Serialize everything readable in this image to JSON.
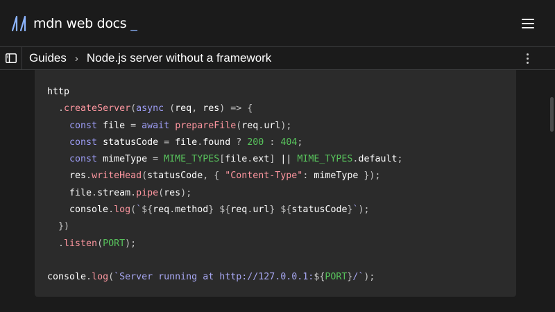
{
  "header": {
    "logo_text": "mdn web docs",
    "logo_cursor": "_",
    "logo_icon": "mdn-m-icon",
    "menu_icon": "hamburger-menu-icon"
  },
  "breadcrumb": {
    "sidebar_icon": "sidebar-toggle-icon",
    "items": [
      "Guides",
      "Node.js server without a framework"
    ],
    "separator": "›",
    "more_icon": "more-vertical-icon"
  },
  "code": {
    "lines": [
      [
        {
          "t": "http",
          "c": ""
        }
      ],
      [
        {
          "t": "  ",
          "c": ""
        },
        {
          "t": ".",
          "c": "p"
        },
        {
          "t": "createServer",
          "c": "f"
        },
        {
          "t": "(",
          "c": "p"
        },
        {
          "t": "async",
          "c": "k"
        },
        {
          "t": " (",
          "c": "p"
        },
        {
          "t": "req",
          "c": ""
        },
        {
          "t": ", ",
          "c": "p"
        },
        {
          "t": "res",
          "c": ""
        },
        {
          "t": ") => {",
          "c": "p"
        }
      ],
      [
        {
          "t": "    ",
          "c": ""
        },
        {
          "t": "const",
          "c": "k"
        },
        {
          "t": " file ",
          "c": ""
        },
        {
          "t": "=",
          "c": "p"
        },
        {
          "t": " ",
          "c": ""
        },
        {
          "t": "await",
          "c": "k"
        },
        {
          "t": " ",
          "c": ""
        },
        {
          "t": "prepareFile",
          "c": "f"
        },
        {
          "t": "(",
          "c": "p"
        },
        {
          "t": "req",
          "c": ""
        },
        {
          "t": ".",
          "c": "p"
        },
        {
          "t": "url",
          "c": ""
        },
        {
          "t": ");",
          "c": "p"
        }
      ],
      [
        {
          "t": "    ",
          "c": ""
        },
        {
          "t": "const",
          "c": "k"
        },
        {
          "t": " statusCode ",
          "c": ""
        },
        {
          "t": "=",
          "c": "p"
        },
        {
          "t": " file",
          "c": ""
        },
        {
          "t": ".",
          "c": "p"
        },
        {
          "t": "found ",
          "c": ""
        },
        {
          "t": "?",
          "c": "p"
        },
        {
          "t": " ",
          "c": ""
        },
        {
          "t": "200",
          "c": "n"
        },
        {
          "t": " : ",
          "c": "p"
        },
        {
          "t": "404",
          "c": "n"
        },
        {
          "t": ";",
          "c": "p"
        }
      ],
      [
        {
          "t": "    ",
          "c": ""
        },
        {
          "t": "const",
          "c": "k"
        },
        {
          "t": " mimeType ",
          "c": ""
        },
        {
          "t": "=",
          "c": "p"
        },
        {
          "t": " ",
          "c": ""
        },
        {
          "t": "MIME_TYPES",
          "c": "n"
        },
        {
          "t": "[",
          "c": "p"
        },
        {
          "t": "file",
          "c": ""
        },
        {
          "t": ".",
          "c": "p"
        },
        {
          "t": "ext",
          "c": ""
        },
        {
          "t": "] ",
          "c": "p"
        },
        {
          "t": "||",
          "c": ""
        },
        {
          "t": " ",
          "c": ""
        },
        {
          "t": "MIME_TYPES",
          "c": "n"
        },
        {
          "t": ".",
          "c": "p"
        },
        {
          "t": "default",
          "c": ""
        },
        {
          "t": ";",
          "c": "p"
        }
      ],
      [
        {
          "t": "    res",
          "c": ""
        },
        {
          "t": ".",
          "c": "p"
        },
        {
          "t": "writeHead",
          "c": "f"
        },
        {
          "t": "(",
          "c": "p"
        },
        {
          "t": "statusCode",
          "c": ""
        },
        {
          "t": ", { ",
          "c": "p"
        },
        {
          "t": "\"Content-Type\"",
          "c": "f"
        },
        {
          "t": ": ",
          "c": "p"
        },
        {
          "t": "mimeType ",
          "c": ""
        },
        {
          "t": "});",
          "c": "p"
        }
      ],
      [
        {
          "t": "    file",
          "c": ""
        },
        {
          "t": ".",
          "c": "p"
        },
        {
          "t": "stream",
          "c": ""
        },
        {
          "t": ".",
          "c": "p"
        },
        {
          "t": "pipe",
          "c": "f"
        },
        {
          "t": "(",
          "c": "p"
        },
        {
          "t": "res",
          "c": ""
        },
        {
          "t": ");",
          "c": "p"
        }
      ],
      [
        {
          "t": "    console",
          "c": ""
        },
        {
          "t": ".",
          "c": "p"
        },
        {
          "t": "log",
          "c": "f"
        },
        {
          "t": "(",
          "c": "p"
        },
        {
          "t": "`",
          "c": "s"
        },
        {
          "t": "${",
          "c": "p"
        },
        {
          "t": "req",
          "c": ""
        },
        {
          "t": ".",
          "c": "p"
        },
        {
          "t": "method",
          "c": ""
        },
        {
          "t": "}",
          "c": "p"
        },
        {
          "t": " ",
          "c": "s"
        },
        {
          "t": "${",
          "c": "p"
        },
        {
          "t": "req",
          "c": ""
        },
        {
          "t": ".",
          "c": "p"
        },
        {
          "t": "url",
          "c": ""
        },
        {
          "t": "}",
          "c": "p"
        },
        {
          "t": " ",
          "c": "s"
        },
        {
          "t": "${",
          "c": "p"
        },
        {
          "t": "statusCode",
          "c": ""
        },
        {
          "t": "}",
          "c": "p"
        },
        {
          "t": "`",
          "c": "s"
        },
        {
          "t": ");",
          "c": "p"
        }
      ],
      [
        {
          "t": "  ",
          "c": ""
        },
        {
          "t": "})",
          "c": "p"
        }
      ],
      [
        {
          "t": "  ",
          "c": ""
        },
        {
          "t": ".",
          "c": "p"
        },
        {
          "t": "listen",
          "c": "f"
        },
        {
          "t": "(",
          "c": "p"
        },
        {
          "t": "PORT",
          "c": "n"
        },
        {
          "t": ");",
          "c": "p"
        }
      ],
      [
        {
          "t": "",
          "c": ""
        }
      ],
      [
        {
          "t": "console",
          "c": ""
        },
        {
          "t": ".",
          "c": "p"
        },
        {
          "t": "log",
          "c": "f"
        },
        {
          "t": "(",
          "c": "p"
        },
        {
          "t": "`Server running at http://127.0.0.1:",
          "c": "s"
        },
        {
          "t": "${",
          "c": "p"
        },
        {
          "t": "PORT",
          "c": "n"
        },
        {
          "t": "}",
          "c": "p"
        },
        {
          "t": "/`",
          "c": "s"
        },
        {
          "t": ");",
          "c": "p"
        }
      ]
    ]
  }
}
